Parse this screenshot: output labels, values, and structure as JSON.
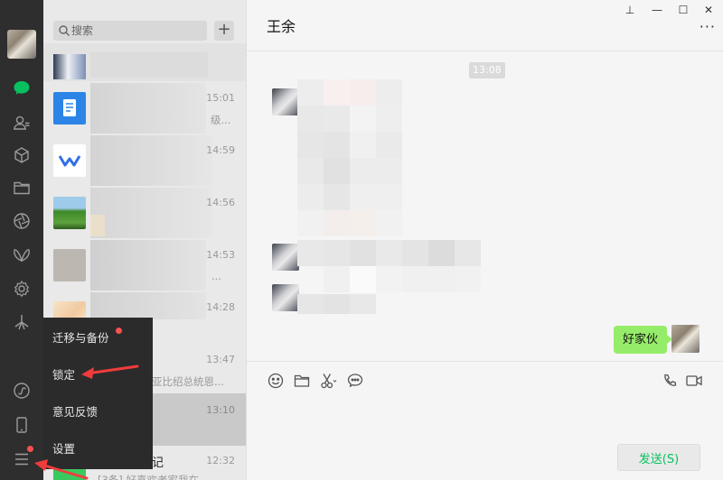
{
  "sidebar": {
    "icons": [
      "chat-icon",
      "contacts-icon",
      "cube-icon",
      "folder-icon",
      "aperture-icon",
      "butterfly-icon",
      "settings-gear-icon",
      "spark-icon",
      "mini-program-icon",
      "phone-device-icon",
      "menu-icon"
    ],
    "accent_color": "#07c160"
  },
  "search": {
    "placeholder": "搜索",
    "add_label": "+"
  },
  "conversations": [
    {
      "time": "",
      "preview": ""
    },
    {
      "time": "15:01",
      "preview": "级..."
    },
    {
      "time": "14:59",
      "preview": ""
    },
    {
      "time": "14:56",
      "preview": ""
    },
    {
      "time": "14:53",
      "preview": "..."
    },
    {
      "time": "14:28",
      "preview": ""
    },
    {
      "time": "13:47",
      "preview": "亚比绍总统恩..."
    },
    {
      "time": "13:10",
      "preview": ""
    },
    {
      "time": "12:32",
      "name": "记",
      "preview": "[3条] 好喜欢老家我在..."
    }
  ],
  "chat": {
    "title": "王余",
    "more_label": "···",
    "window_buttons": {
      "pin": "⊥",
      "minimize": "—",
      "maximize": "☐",
      "close": "✕"
    },
    "timestamp": "13:08",
    "my_message": "好家伙",
    "send_label": "发送(S)"
  },
  "menu": {
    "items": [
      "迁移与备份",
      "锁定",
      "意见反馈",
      "设置"
    ],
    "badge_color": "#fa5151",
    "arrow_color": "#f03c3c"
  }
}
